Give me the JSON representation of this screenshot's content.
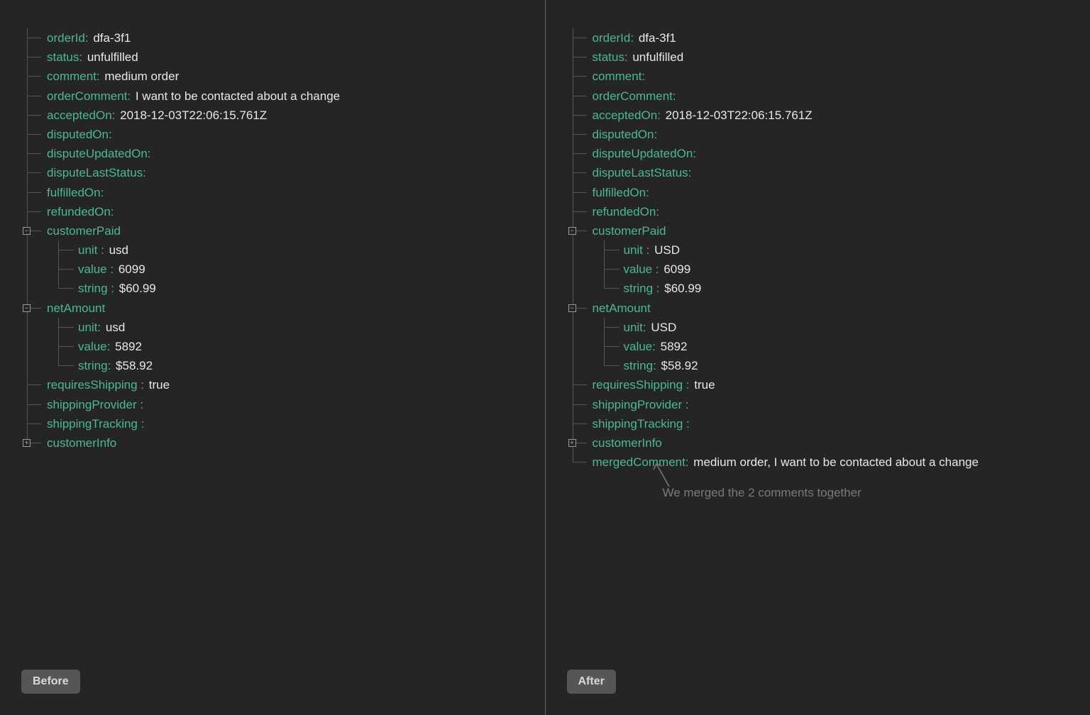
{
  "before": {
    "orderId": {
      "k": "orderId:",
      "v": "dfa-3f1"
    },
    "status": {
      "k": "status:",
      "v": "unfulfilled"
    },
    "comment": {
      "k": "comment:",
      "v": "medium order"
    },
    "orderComment": {
      "k": "orderComment:",
      "v": " I want to be contacted about a change"
    },
    "acceptedOn": {
      "k": "acceptedOn:",
      "v": "2018-12-03T22:06:15.761Z"
    },
    "disputedOn": {
      "k": "disputedOn:",
      "v": ""
    },
    "disputeUpdatedOn": {
      "k": "disputeUpdatedOn:",
      "v": ""
    },
    "disputeLastStatus": {
      "k": "disputeLastStatus:",
      "v": ""
    },
    "fulfilledOn": {
      "k": "fulfilledOn:",
      "v": ""
    },
    "refundedOn": {
      "k": "refundedOn:",
      "v": ""
    },
    "customerPaid": {
      "k": "customerPaid",
      "unit": {
        "k": "unit :",
        "v": "usd"
      },
      "value": {
        "k": "value :",
        "v": "6099"
      },
      "string": {
        "k": "string :",
        "v": "$60.99"
      }
    },
    "netAmount": {
      "k": "netAmount",
      "unit": {
        "k": "unit:",
        "v": "usd"
      },
      "value": {
        "k": "value:",
        "v": "5892"
      },
      "string": {
        "k": "string:",
        "v": "$58.92"
      }
    },
    "requiresShipping": {
      "k": "requiresShipping :",
      "v": "true"
    },
    "shippingProvider": {
      "k": "shippingProvider :",
      "v": ""
    },
    "shippingTracking": {
      "k": "shippingTracking :",
      "v": ""
    },
    "customerInfo": {
      "k": "customerInfo"
    },
    "badge": "Before"
  },
  "after": {
    "orderId": {
      "k": "orderId:",
      "v": "dfa-3f1"
    },
    "status": {
      "k": "status:",
      "v": "unfulfilled"
    },
    "comment": {
      "k": "comment:",
      "v": ""
    },
    "orderComment": {
      "k": "orderComment:",
      "v": ""
    },
    "acceptedOn": {
      "k": "acceptedOn:",
      "v": "2018-12-03T22:06:15.761Z"
    },
    "disputedOn": {
      "k": "disputedOn:",
      "v": ""
    },
    "disputeUpdatedOn": {
      "k": "disputeUpdatedOn:",
      "v": ""
    },
    "disputeLastStatus": {
      "k": "disputeLastStatus:",
      "v": ""
    },
    "fulfilledOn": {
      "k": "fulfilledOn:",
      "v": ""
    },
    "refundedOn": {
      "k": "refundedOn:",
      "v": ""
    },
    "customerPaid": {
      "k": "customerPaid",
      "unit": {
        "k": "unit :",
        "v": "USD"
      },
      "value": {
        "k": "value :",
        "v": "6099"
      },
      "string": {
        "k": "string :",
        "v": "$60.99"
      }
    },
    "netAmount": {
      "k": "netAmount",
      "unit": {
        "k": "unit:",
        "v": "USD"
      },
      "value": {
        "k": "value:",
        "v": "5892"
      },
      "string": {
        "k": "string:",
        "v": "$58.92"
      }
    },
    "requiresShipping": {
      "k": "requiresShipping :",
      "v": "true"
    },
    "shippingProvider": {
      "k": "shippingProvider :",
      "v": ""
    },
    "shippingTracking": {
      "k": "shippingTracking :",
      "v": ""
    },
    "customerInfo": {
      "k": "customerInfo"
    },
    "mergedComment": {
      "k": "mergedComment:",
      "v": "medium order,  I want to be contacted  about a change"
    },
    "annotation": "We merged the 2 comments together",
    "badge": "After"
  }
}
